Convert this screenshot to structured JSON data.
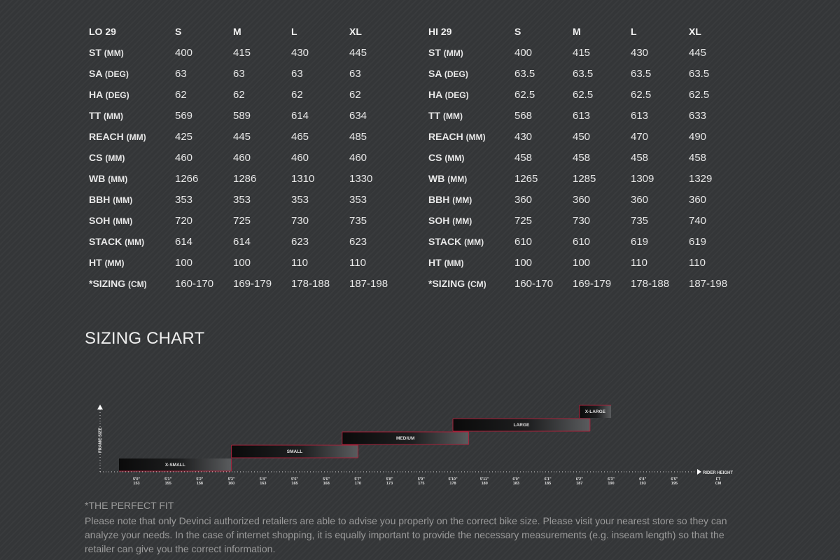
{
  "tables": [
    {
      "name": "LO 29",
      "sizes": [
        "S",
        "M",
        "L",
        "XL"
      ],
      "rows": [
        {
          "label": "ST",
          "unit": "(MM)",
          "values": [
            "400",
            "415",
            "430",
            "445"
          ]
        },
        {
          "label": "SA",
          "unit": "(DEG)",
          "values": [
            "63",
            "63",
            "63",
            "63"
          ]
        },
        {
          "label": "HA",
          "unit": "(DEG)",
          "values": [
            "62",
            "62",
            "62",
            "62"
          ]
        },
        {
          "label": "TT",
          "unit": "(MM)",
          "values": [
            "569",
            "589",
            "614",
            "634"
          ]
        },
        {
          "label": "REACH",
          "unit": "(MM)",
          "values": [
            "425",
            "445",
            "465",
            "485"
          ]
        },
        {
          "label": "CS",
          "unit": "(MM)",
          "values": [
            "460",
            "460",
            "460",
            "460"
          ]
        },
        {
          "label": "WB",
          "unit": "(MM)",
          "values": [
            "1266",
            "1286",
            "1310",
            "1330"
          ]
        },
        {
          "label": "BBH",
          "unit": "(MM)",
          "values": [
            "353",
            "353",
            "353",
            "353"
          ]
        },
        {
          "label": "SOH",
          "unit": "(MM)",
          "values": [
            "720",
            "725",
            "730",
            "735"
          ]
        },
        {
          "label": "STACK",
          "unit": "(MM)",
          "values": [
            "614",
            "614",
            "623",
            "623"
          ]
        },
        {
          "label": "HT",
          "unit": "(MM)",
          "values": [
            "100",
            "100",
            "110",
            "110"
          ]
        },
        {
          "label": "*SIZING",
          "unit": "(CM)",
          "values": [
            "160-170",
            "169-179",
            "178-188",
            "187-198"
          ]
        }
      ]
    },
    {
      "name": "HI 29",
      "sizes": [
        "S",
        "M",
        "L",
        "XL"
      ],
      "rows": [
        {
          "label": "ST",
          "unit": "(MM)",
          "values": [
            "400",
            "415",
            "430",
            "445"
          ]
        },
        {
          "label": "SA",
          "unit": "(DEG)",
          "values": [
            "63.5",
            "63.5",
            "63.5",
            "63.5"
          ]
        },
        {
          "label": "HA",
          "unit": "(DEG)",
          "values": [
            "62.5",
            "62.5",
            "62.5",
            "62.5"
          ]
        },
        {
          "label": "TT",
          "unit": "(MM)",
          "values": [
            "568",
            "613",
            "613",
            "633"
          ]
        },
        {
          "label": "REACH",
          "unit": "(MM)",
          "values": [
            "430",
            "450",
            "470",
            "490"
          ]
        },
        {
          "label": "CS",
          "unit": "(MM)",
          "values": [
            "458",
            "458",
            "458",
            "458"
          ]
        },
        {
          "label": "WB",
          "unit": "(MM)",
          "values": [
            "1265",
            "1285",
            "1309",
            "1329"
          ]
        },
        {
          "label": "BBH",
          "unit": "(MM)",
          "values": [
            "360",
            "360",
            "360",
            "360"
          ]
        },
        {
          "label": "SOH",
          "unit": "(MM)",
          "values": [
            "725",
            "730",
            "735",
            "740"
          ]
        },
        {
          "label": "STACK",
          "unit": "(MM)",
          "values": [
            "610",
            "610",
            "619",
            "619"
          ]
        },
        {
          "label": "HT",
          "unit": "(MM)",
          "values": [
            "100",
            "100",
            "110",
            "110"
          ]
        },
        {
          "label": "*SIZING",
          "unit": "(CM)",
          "values": [
            "160-170",
            "169-179",
            "178-188",
            "187-198"
          ]
        }
      ]
    }
  ],
  "sizing_chart_title": "SIZING CHART",
  "chart_data": {
    "type": "bar",
    "ylabel": "FRAME SIZE",
    "xlabel": "RIDER HEIGHT",
    "x_units": [
      "FT",
      "CM"
    ],
    "ticks": [
      {
        "ft": "5'0\"",
        "cm": "153"
      },
      {
        "ft": "5'1\"",
        "cm": "155"
      },
      {
        "ft": "5'2\"",
        "cm": "158"
      },
      {
        "ft": "5'3\"",
        "cm": "160"
      },
      {
        "ft": "5'4\"",
        "cm": "163"
      },
      {
        "ft": "5'5\"",
        "cm": "165"
      },
      {
        "ft": "5'6\"",
        "cm": "168"
      },
      {
        "ft": "5'7\"",
        "cm": "170"
      },
      {
        "ft": "5'8\"",
        "cm": "173"
      },
      {
        "ft": "5'9\"",
        "cm": "175"
      },
      {
        "ft": "5'10\"",
        "cm": "178"
      },
      {
        "ft": "5'11\"",
        "cm": "180"
      },
      {
        "ft": "6'0\"",
        "cm": "183"
      },
      {
        "ft": "6'1\"",
        "cm": "185"
      },
      {
        "ft": "6'2\"",
        "cm": "187"
      },
      {
        "ft": "6'3\"",
        "cm": "190"
      },
      {
        "ft": "6'4\"",
        "cm": "193"
      },
      {
        "ft": "6'5\"",
        "cm": "195"
      }
    ],
    "bars": [
      {
        "label": "X-SMALL",
        "level": 1,
        "from_cm": 153,
        "to_cm": 160
      },
      {
        "label": "SMALL",
        "level": 2,
        "from_cm": 160,
        "to_cm": 170
      },
      {
        "label": "MEDIUM",
        "level": 3,
        "from_cm": 169,
        "to_cm": 179
      },
      {
        "label": "LARGE",
        "level": 4,
        "from_cm": 178,
        "to_cm": 188
      },
      {
        "label": "X-LARGE",
        "level": 5,
        "from_cm": 187,
        "to_cm": 190
      }
    ],
    "colors": {
      "outline": "#a8213a",
      "bar_dark": "#0a0a0a",
      "bar_light": "#5a5c5e",
      "text": "#e0e0e0"
    }
  },
  "fit": {
    "title": "*THE PERFECT FIT",
    "text": "Please note that only Devinci authorized retailers are able to advise you properly on the correct bike size. Please visit your nearest store so they can analyze your needs. In the case of internet shopping, it is equally important to provide the necessary measurements (e.g. inseam length) so that the retailer can give you the correct information."
  }
}
